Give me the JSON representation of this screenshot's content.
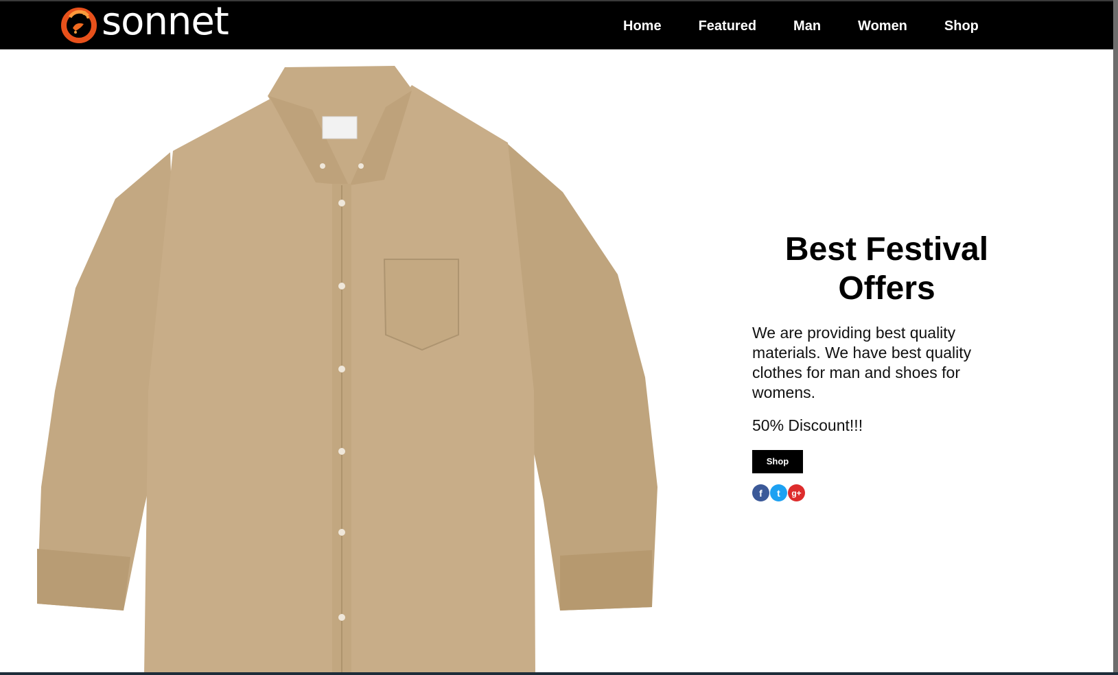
{
  "brand": {
    "name": "sonnet",
    "accent_color": "#e8511b"
  },
  "nav": {
    "items": [
      {
        "label": "Home"
      },
      {
        "label": "Featured"
      },
      {
        "label": "Man"
      },
      {
        "label": "Women"
      },
      {
        "label": "Shop"
      }
    ]
  },
  "hero": {
    "image": "khaki-button-down-shirt"
  },
  "promo": {
    "title": "Best Festival Offers",
    "description": "We are providing best quality materials. We have best quality clothes for man and shoes for womens.",
    "discount": "50% Discount!!!",
    "button_label": "Shop"
  },
  "social": [
    {
      "name": "facebook-icon",
      "glyph": "f",
      "color": "#3b5998"
    },
    {
      "name": "twitter-icon",
      "glyph": "t",
      "color": "#1da1f2"
    },
    {
      "name": "google-plus-icon",
      "glyph": "g+",
      "color": "#dd2c2c"
    }
  ]
}
